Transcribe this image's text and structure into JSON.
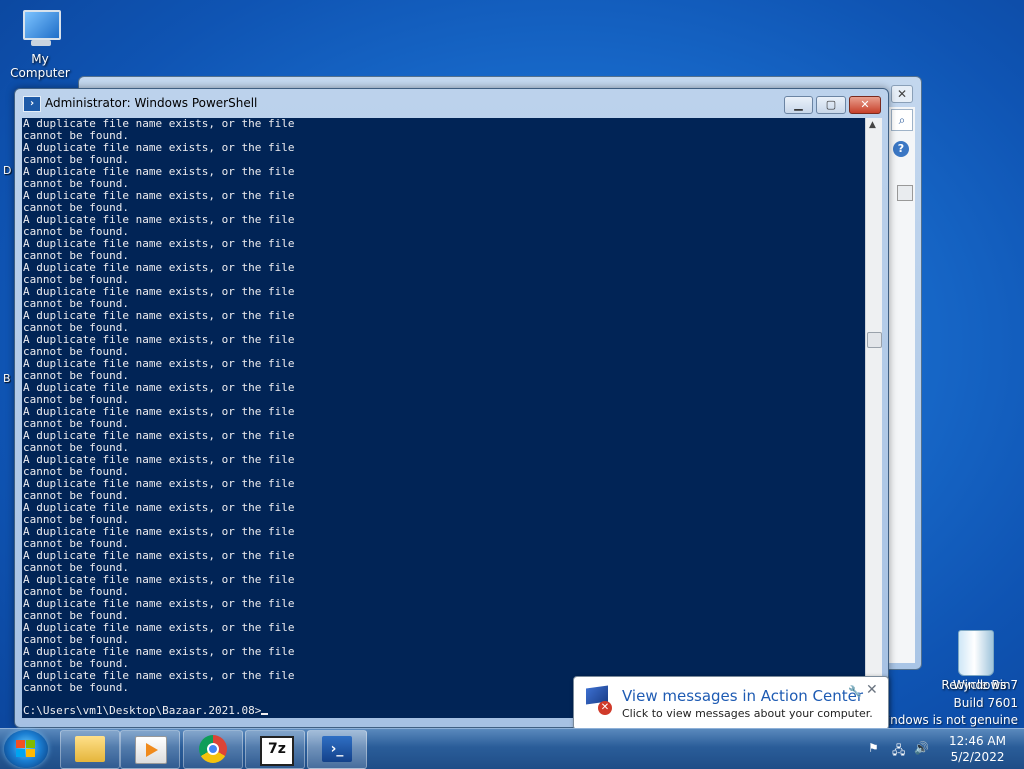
{
  "desktop": {
    "my_computer_label": "My Computer",
    "recycle_bin_label": "Recycle Bin",
    "edge_letters": [
      "D",
      "B"
    ],
    "watermark": [
      "Windows 7",
      "Build 7601",
      "Windows is not genuine"
    ]
  },
  "background_window": {
    "close_glyph": "✕",
    "search_glyph": "⌕",
    "help_glyph": "?"
  },
  "powershell": {
    "title": "Administrator: Windows PowerShell",
    "output_line_1": "A duplicate file name exists, or the file",
    "output_line_2": "cannot be found.",
    "repeat_count": 24,
    "prompt": "C:\\Users\\vm1\\Desktop\\Bazaar.2021.08>",
    "min_glyph": "▁",
    "max_glyph": "▢",
    "close_glyph": "✕",
    "icon_glyph": "›"
  },
  "notification": {
    "title": "View messages in Action Center",
    "subtitle": "Click to view messages about your computer.",
    "close_glyph": "✕",
    "settings_glyph": "🔧"
  },
  "taskbar": {
    "apps": [
      {
        "name": "Windows Explorer",
        "icon": "folder-icon"
      },
      {
        "name": "Windows Media Player",
        "icon": "media-player-icon"
      },
      {
        "name": "Google Chrome",
        "icon": "chrome-icon"
      },
      {
        "name": "7-Zip",
        "icon": "7zip-icon",
        "glyph": "7z"
      },
      {
        "name": "Windows PowerShell",
        "icon": "powershell-icon",
        "glyph": "›_",
        "active": true
      }
    ],
    "clock_time": "12:46 AM",
    "clock_date": "5/2/2022"
  }
}
